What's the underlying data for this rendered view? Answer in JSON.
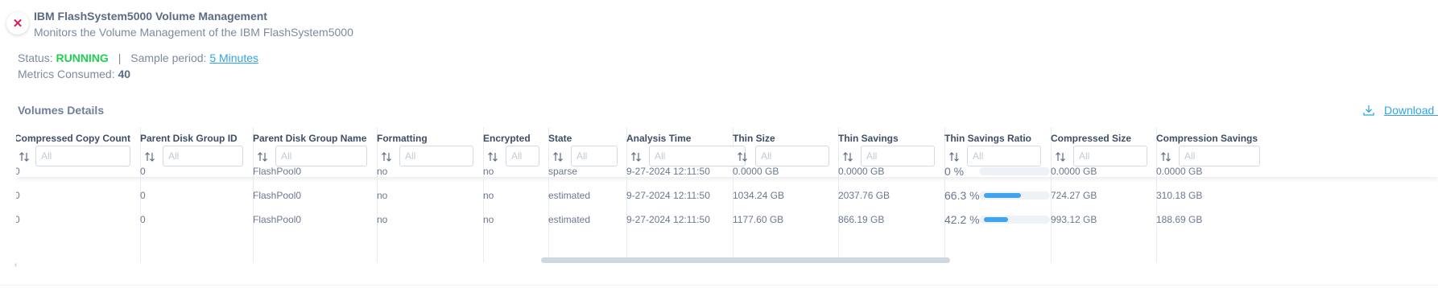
{
  "header": {
    "title": "IBM FlashSystem5000 Volume Management",
    "subtitle": "Monitors the Volume Management of the IBM FlashSystem5000",
    "close_icon": "close-icon"
  },
  "status": {
    "label": "Status:",
    "value": "RUNNING",
    "separator": "|",
    "sample_label": "Sample period:",
    "sample_value": "5 Minutes",
    "metrics_label": "Metrics Consumed:",
    "metrics_value": "40"
  },
  "section": {
    "title": "Volumes Details",
    "download_label": "Download C",
    "download_icon": "download-icon"
  },
  "table": {
    "filter_placeholder": "All",
    "sort_icon": "sort-icon",
    "columns": [
      {
        "label": "Compressed Copy Count"
      },
      {
        "label": "Parent Disk Group ID"
      },
      {
        "label": "Parent Disk Group Name"
      },
      {
        "label": "Formatting"
      },
      {
        "label": "Encrypted"
      },
      {
        "label": "State"
      },
      {
        "label": "Analysis Time"
      },
      {
        "label": "Thin Size"
      },
      {
        "label": "Thin Savings"
      },
      {
        "label": "Thin Savings Ratio"
      },
      {
        "label": "Compressed Size"
      },
      {
        "label": "Compression Savings"
      }
    ],
    "rows": [
      {
        "cells": [
          "0",
          "0",
          "FlashPool0",
          "no",
          "no",
          "sparse",
          "9-27-2024 12:11:50",
          "0.0000 GB",
          "0.0000 GB",
          "0 %",
          "0.0000 GB",
          "0.0000 GB"
        ],
        "ratio": 0
      },
      {
        "cells": [
          "0",
          "0",
          "FlashPool0",
          "no",
          "no",
          "estimated",
          "9-27-2024 12:11:50",
          "1034.24 GB",
          "2037.76 GB",
          "66.3 %",
          "724.27 GB",
          "310.18 GB"
        ],
        "ratio": 66.3
      },
      {
        "cells": [
          "0",
          "0",
          "FlashPool0",
          "no",
          "no",
          "estimated",
          "9-27-2024 12:11:50",
          "1177.60 GB",
          "866.19 GB",
          "42.2 %",
          "993.12 GB",
          "188.69 GB"
        ],
        "ratio": 42.2
      }
    ]
  },
  "scroll": {
    "left_arrow": "‹",
    "left_arrow_icon": "chevron-left-icon"
  },
  "colors": {
    "accent": "#2fa4e7",
    "running": "#1fd055",
    "close": "#d81b60",
    "ratio_bar": "#3ea4ee",
    "ratio_track": "#eef1f5"
  }
}
